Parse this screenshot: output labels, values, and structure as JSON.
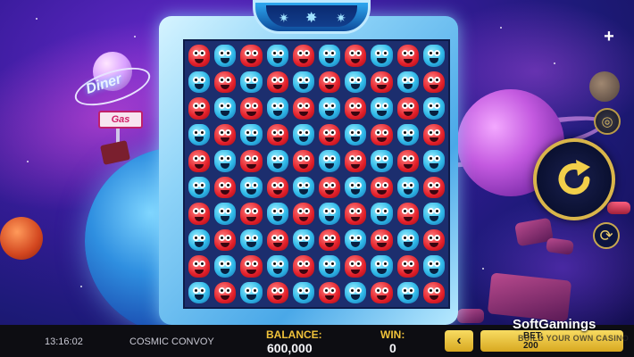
{
  "game": {
    "title": "COSMIC CONVOY",
    "clock": "13:16:02",
    "sign_diner": "Diner",
    "sign_gas": "Gas"
  },
  "grid": {
    "rows": 10,
    "cols": 10,
    "symbols": [
      [
        "red",
        "blue",
        "red",
        "blue",
        "red",
        "blue",
        "red",
        "blue",
        "red",
        "blue"
      ],
      [
        "blue",
        "red",
        "blue",
        "red",
        "blue",
        "red",
        "blue",
        "red",
        "blue",
        "red"
      ],
      [
        "red",
        "blue",
        "red",
        "blue",
        "red",
        "blue",
        "red",
        "blue",
        "red",
        "blue"
      ],
      [
        "blue",
        "red",
        "blue",
        "red",
        "blue",
        "red",
        "blue",
        "red",
        "blue",
        "red"
      ],
      [
        "red",
        "blue",
        "red",
        "blue",
        "red",
        "blue",
        "red",
        "blue",
        "red",
        "blue"
      ],
      [
        "blue",
        "red",
        "blue",
        "red",
        "blue",
        "red",
        "blue",
        "red",
        "blue",
        "red"
      ],
      [
        "red",
        "blue",
        "red",
        "blue",
        "red",
        "blue",
        "red",
        "blue",
        "red",
        "blue"
      ],
      [
        "blue",
        "red",
        "blue",
        "red",
        "blue",
        "red",
        "blue",
        "red",
        "blue",
        "red"
      ],
      [
        "red",
        "blue",
        "red",
        "blue",
        "red",
        "blue",
        "red",
        "blue",
        "red",
        "blue"
      ],
      [
        "blue",
        "red",
        "blue",
        "red",
        "blue",
        "red",
        "blue",
        "red",
        "blue",
        "red"
      ]
    ]
  },
  "controls": {
    "plus_icon": "plus-icon",
    "coin_icon": "coin-stack-icon",
    "spin_icon": "spin-arrow-icon",
    "autoplay_icon": "autoplay-icon",
    "bet_prev_label": "‹"
  },
  "footer": {
    "balance_label": "BALANCE:",
    "balance_value": "600,000",
    "win_label": "WIN:",
    "win_value": "0",
    "bet_label": "BET:",
    "bet_value": "200"
  },
  "watermark": {
    "brand": "SoftGamings",
    "tagline": "BUILD YOUR OWN CASINO"
  },
  "colors": {
    "accent_gold": "#f0c23a",
    "red_symbol": "#e3202a",
    "blue_symbol": "#2fb8e8"
  }
}
